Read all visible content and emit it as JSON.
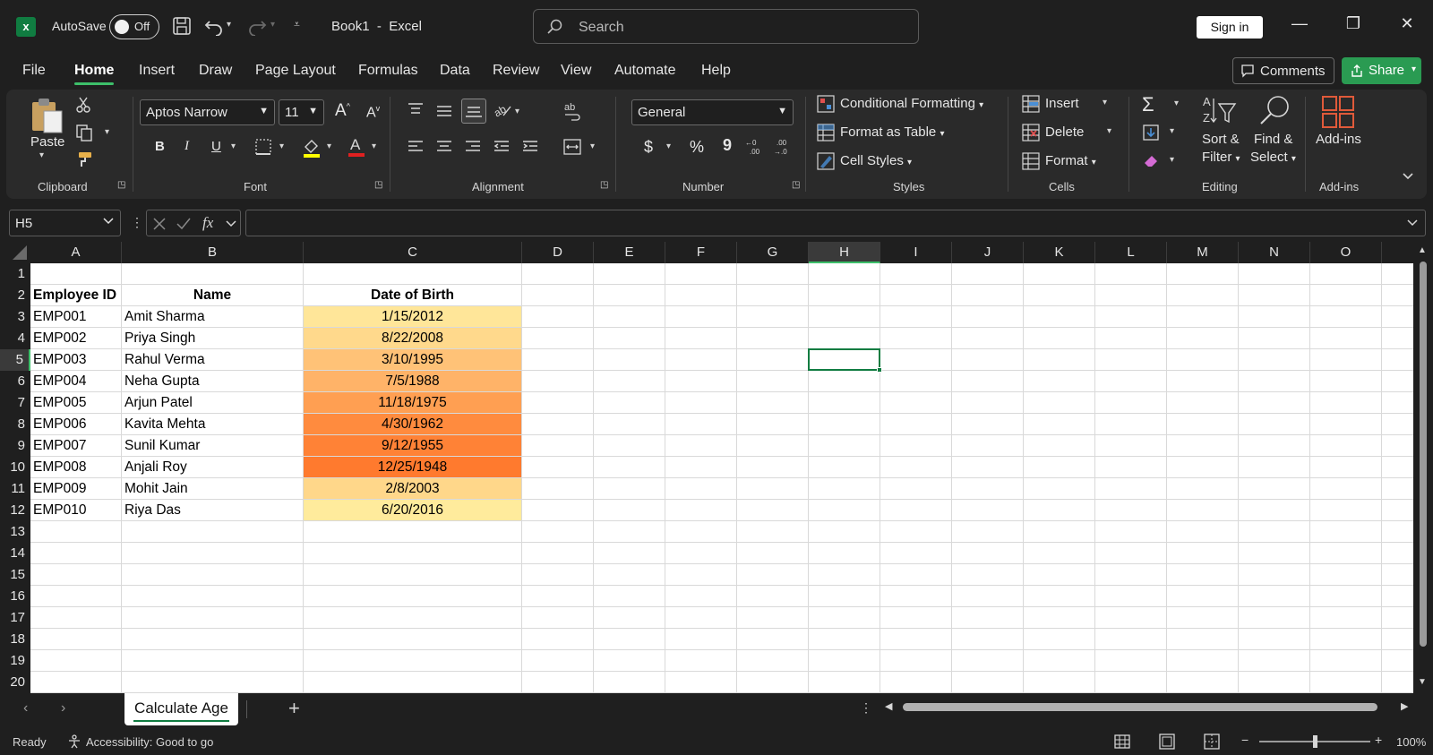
{
  "app": {
    "doc_title": "Book1",
    "app_name": "Excel",
    "autosave_label": "AutoSave",
    "autosave_state": "Off",
    "search_placeholder": "Search",
    "signin_label": "Sign in"
  },
  "menu": {
    "tabs": [
      "File",
      "Home",
      "Insert",
      "Draw",
      "Page Layout",
      "Formulas",
      "Data",
      "Review",
      "View",
      "Automate",
      "Help"
    ],
    "active": "Home",
    "comments_label": "Comments",
    "share_label": "Share"
  },
  "ribbon": {
    "clipboard": {
      "label": "Clipboard",
      "paste": "Paste"
    },
    "font": {
      "label": "Font",
      "family": "Aptos Narrow",
      "size": "11",
      "bold": "B",
      "italic": "I",
      "underline": "U"
    },
    "alignment": {
      "label": "Alignment"
    },
    "number": {
      "label": "Number",
      "format": "General",
      "currency": "$",
      "percent": "%",
      "comma": "9"
    },
    "styles": {
      "label": "Styles",
      "conditional": "Conditional Formatting",
      "format_table": "Format as Table",
      "cell_styles": "Cell Styles"
    },
    "cells": {
      "label": "Cells",
      "insert": "Insert",
      "delete": "Delete",
      "format": "Format"
    },
    "editing": {
      "label": "Editing",
      "sort1": "Sort &",
      "sort2": "Filter",
      "find1": "Find &",
      "find2": "Select"
    },
    "addins": {
      "label": "Add-ins",
      "button": "Add-ins"
    }
  },
  "formula_bar": {
    "name_box": "H5",
    "fx": "fx",
    "value": ""
  },
  "grid": {
    "columns": [
      "A",
      "B",
      "C",
      "D",
      "E",
      "F",
      "G",
      "H",
      "I",
      "J",
      "K",
      "L",
      "M",
      "N",
      "O"
    ],
    "rows": [
      "1",
      "2",
      "3",
      "4",
      "5",
      "6",
      "7",
      "8",
      "9",
      "10",
      "11",
      "12",
      "13",
      "14",
      "15",
      "16",
      "17",
      "18",
      "19",
      "20"
    ],
    "selected_col": "H",
    "selected_row": "5",
    "headers": {
      "a": "Employee ID",
      "b": "Name",
      "c": "Date of Birth"
    },
    "data": [
      {
        "id": "EMP001",
        "name": "Amit Sharma",
        "dob": "1/15/2012",
        "color": "#ffe699"
      },
      {
        "id": "EMP002",
        "name": "Priya Singh",
        "dob": "8/22/2008",
        "color": "#ffd98c"
      },
      {
        "id": "EMP003",
        "name": "Rahul Verma",
        "dob": "3/10/1995",
        "color": "#ffc277"
      },
      {
        "id": "EMP004",
        "name": "Neha Gupta",
        "dob": "7/5/1988",
        "color": "#ffb368"
      },
      {
        "id": "EMP005",
        "name": "Arjun Patel",
        "dob": "11/18/1975",
        "color": "#ff9f52"
      },
      {
        "id": "EMP006",
        "name": "Kavita Mehta",
        "dob": "4/30/1962",
        "color": "#ff8b3e"
      },
      {
        "id": "EMP007",
        "name": "Sunil Kumar",
        "dob": "9/12/1955",
        "color": "#ff8236"
      },
      {
        "id": "EMP008",
        "name": "Anjali Roy",
        "dob": "12/25/1948",
        "color": "#ff7a2e"
      },
      {
        "id": "EMP009",
        "name": "Mohit Jain",
        "dob": "2/8/2003",
        "color": "#ffd78a"
      },
      {
        "id": "EMP010",
        "name": "Riya Das",
        "dob": "6/20/2016",
        "color": "#ffeb9c"
      }
    ]
  },
  "sheets": {
    "active": "Calculate Age",
    "add": "+"
  },
  "status": {
    "ready": "Ready",
    "accessibility": "Accessibility: Good to go",
    "zoom": "100%",
    "zoom_level": 0.5
  }
}
